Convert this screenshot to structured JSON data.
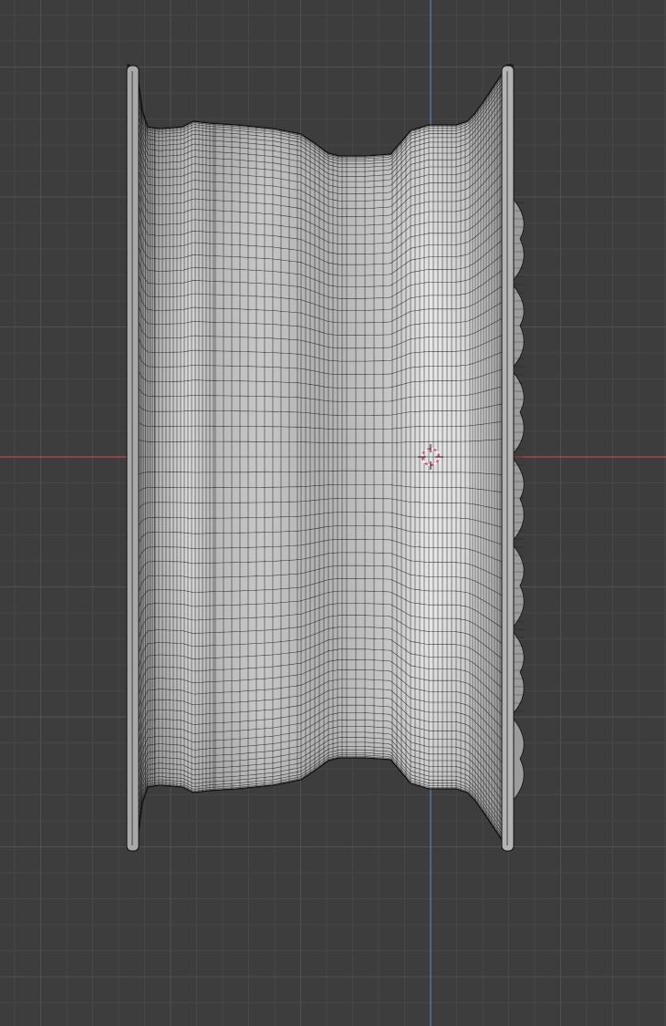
{
  "viewport": {
    "background": "#3d3d3d",
    "grid_minor_color": "#474747",
    "grid_major_color": "#515151",
    "x_axis_color": "#c34650",
    "y_axis_color": "#4f86c8",
    "wire_color": "#111111",
    "cursor_outer_color": "#f0f0f0",
    "cursor_accent_color": "#e0407a"
  },
  "object": {
    "kind": "wheel-rim-mesh",
    "fill_light": "#cfcfcf",
    "fill_dark": "#8e8e8e",
    "icons": {
      "cursor": "3d-cursor-icon"
    }
  }
}
